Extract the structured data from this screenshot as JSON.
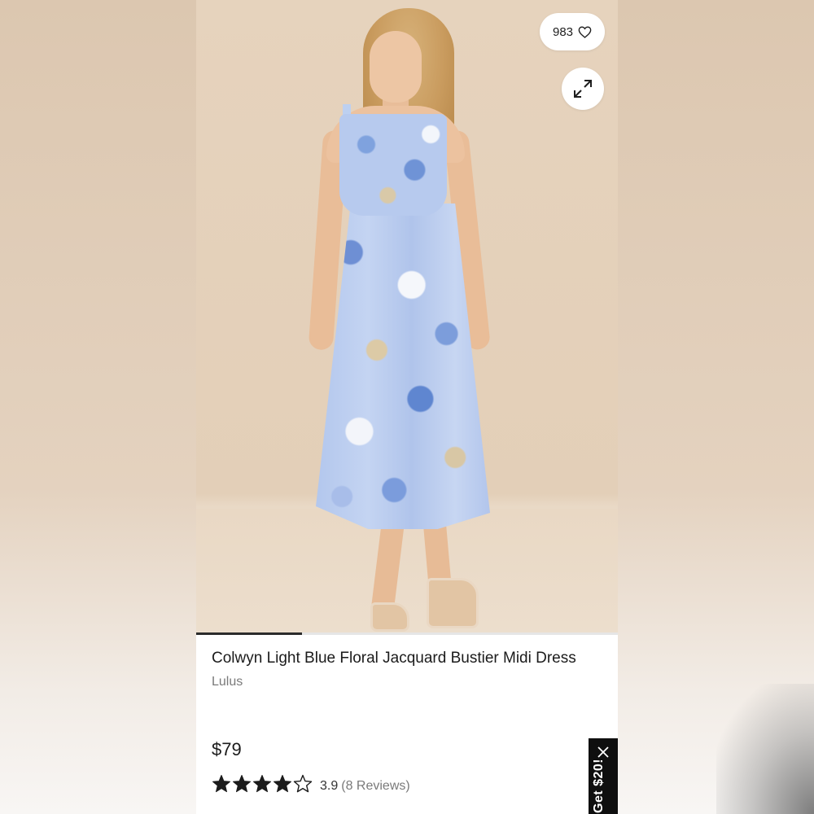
{
  "product": {
    "title": "Colwyn Light Blue Floral Jacquard Bustier Midi Dress",
    "brand": "Lulus",
    "price": "$79",
    "rating_value": "3.9",
    "rating_stars": 3.9,
    "reviews_label": "(8 Reviews)"
  },
  "gallery": {
    "like_count": "983",
    "progress": 0.25
  },
  "promo": {
    "text": "Get $20!"
  },
  "icons": {
    "like": "heart-outline-icon",
    "expand": "expand-arrows-icon",
    "close": "close-icon",
    "star_full": "star-filled-icon",
    "star_empty": "star-outline-icon"
  },
  "colors": {
    "star": "#1b1b1b",
    "promo_bg": "#0f0f0f",
    "progress": "#2b2b2b"
  }
}
